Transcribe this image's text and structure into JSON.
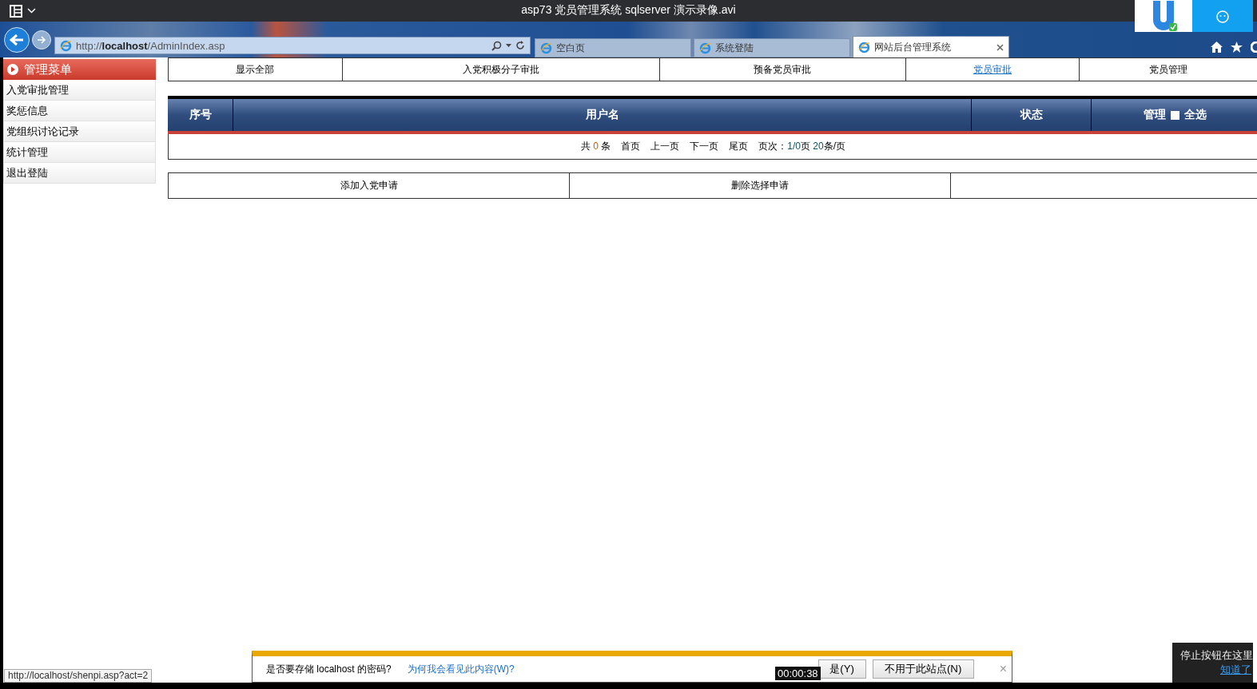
{
  "player": {
    "title": "asp73 党员管理系统 sqlserver 演示录像.avi",
    "timestamp": "00:00:38",
    "hint": {
      "text": "停止按钮在这里",
      "link": "知道了"
    }
  },
  "browser": {
    "address": {
      "scheme": "http://",
      "host": "localhost",
      "path": "/AdminIndex.asp"
    },
    "tabs": [
      {
        "label": "空白页",
        "selected": false
      },
      {
        "label": "系统登陆",
        "selected": false
      },
      {
        "label": "网站后台管理系统",
        "selected": true
      }
    ],
    "status_url": "http://localhost/shenpi.asp?act=2"
  },
  "sidebar": {
    "title": "管理菜单",
    "items": [
      "入党审批管理",
      "奖惩信息",
      "党组织讨论记录",
      "统计管理",
      "退出登陆"
    ]
  },
  "nav": [
    {
      "label": "显示全部",
      "hovered": false
    },
    {
      "label": "入党积极分子审批",
      "hovered": false
    },
    {
      "label": "预备党员审批",
      "hovered": false
    },
    {
      "label": "党员审批",
      "hovered": true
    },
    {
      "label": "党员管理",
      "hovered": false
    }
  ],
  "table": {
    "columns": [
      "序号",
      "用户名",
      "状态",
      "管理"
    ],
    "select_all": {
      "label": "全选",
      "checked": false
    },
    "pager": {
      "prefix": "共",
      "total": "0",
      "suffix": "条",
      "links": [
        "首页",
        "上一页",
        "下一页",
        "尾页"
      ],
      "page_label": "页次：",
      "page": "1/0",
      "page_unit": "页",
      "per_page": "20",
      "per_page_unit": "条/页"
    }
  },
  "actions": [
    "添加入党申请",
    "删除选择申请"
  ],
  "password_bar": {
    "question": "是否要存储 localhost 的密码?",
    "link": "为何我会看见此内容(W)?",
    "buttons": [
      "是(Y)",
      "不用于此站点(N)"
    ],
    "close": "×"
  }
}
